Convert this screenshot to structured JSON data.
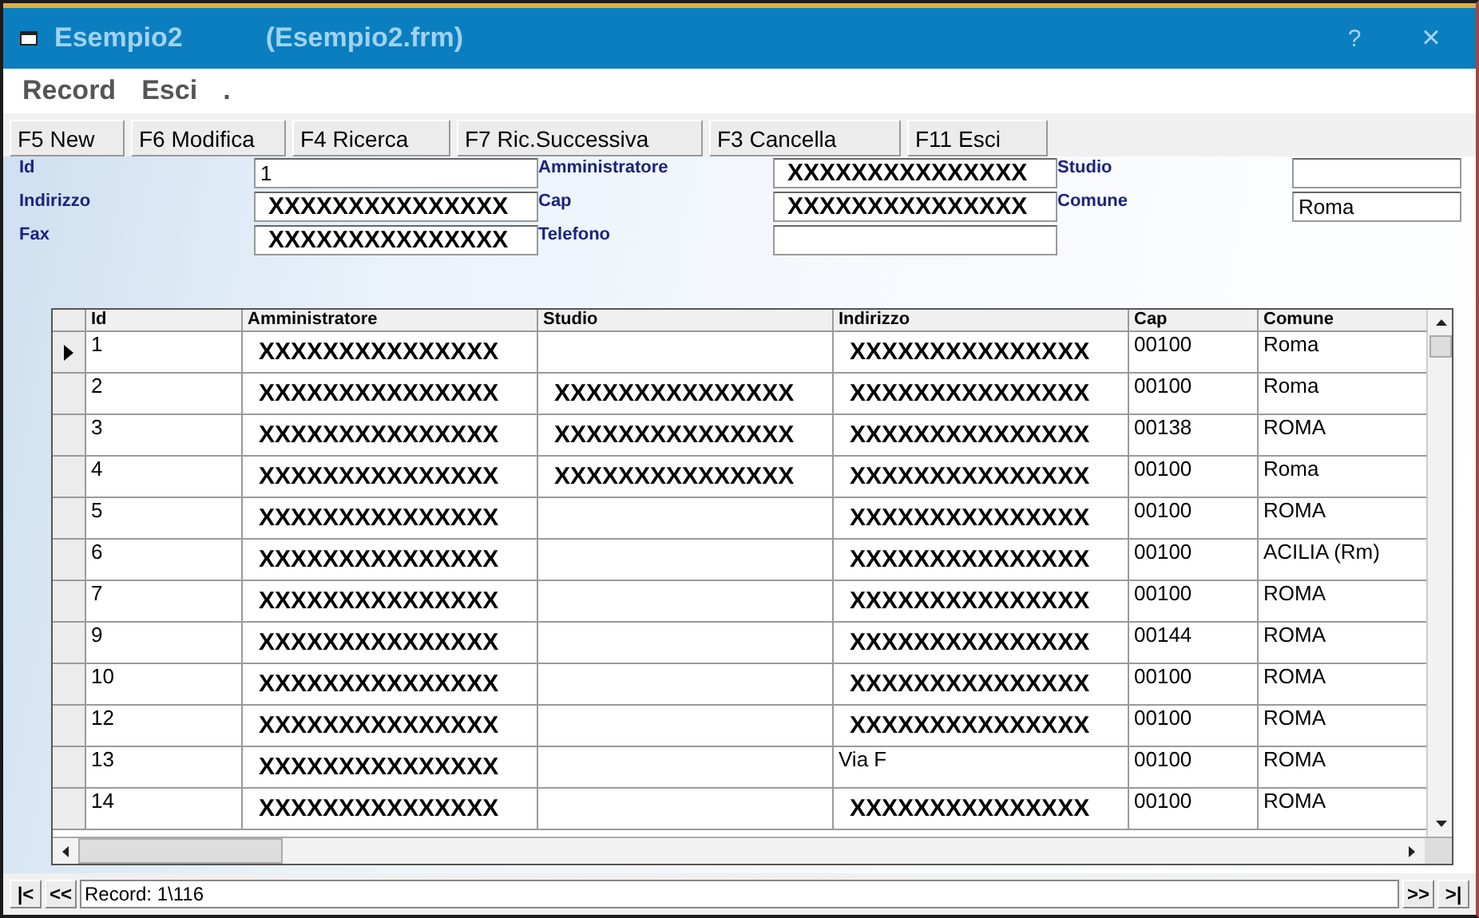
{
  "window": {
    "title": "Esempio2",
    "subtitle": "(Esempio2.frm)",
    "buttons": [
      "?",
      "×"
    ]
  },
  "menu": [
    "Record",
    "Esci",
    "."
  ],
  "toolbar": [
    "F5 New",
    "F6 Modifica",
    "F4 Ricerca",
    "F7 Ric.Successiva",
    "F3 Cancella",
    "F11 Esci"
  ],
  "form": [
    [
      {
        "label": "Id",
        "value": "1"
      },
      {
        "label": "Indirizzo",
        "value": "XXXXXXXXXXXXXXX"
      },
      {
        "label": "Fax",
        "value": "XXXXXXXXXXXXXXX"
      }
    ],
    [
      {
        "label": "Amministratore",
        "value": "XXXXXXXXXXXXXXX"
      },
      {
        "label": "Cap",
        "value": "XXXXXXXXXXXXXXX"
      },
      {
        "label": "Telefono"
      }
    ],
    [
      {
        "label": "Studio"
      },
      {
        "label": "Comune",
        "value": "Roma"
      }
    ]
  ],
  "table": {
    "columns": [
      "Id",
      "Amministratore",
      "Studio",
      "Indirizzo",
      "Cap",
      "Comune"
    ],
    "rows": [
      {
        "selected": true,
        "cells": [
          "1",
          "XXXXXXXXXXXXXXX",
          "",
          "XXXXXXXXXXXXXXX",
          "00100",
          "Roma"
        ]
      },
      {
        "selected": false,
        "cells": [
          "2",
          "XXXXXXXXXXXXXXX",
          "XXXXXXXXXXXXXXX",
          "XXXXXXXXXXXXXXX",
          "00100",
          "Roma"
        ]
      },
      {
        "selected": false,
        "cells": [
          "3",
          "XXXXXXXXXXXXXXX",
          "XXXXXXXXXXXXXXX",
          "XXXXXXXXXXXXXXX",
          "00138",
          "ROMA"
        ]
      },
      {
        "selected": false,
        "cells": [
          "4",
          "XXXXXXXXXXXXXXX",
          "XXXXXXXXXXXXXXX",
          "XXXXXXXXXXXXXXX",
          "00100",
          "Roma"
        ]
      },
      {
        "selected": false,
        "cells": [
          "5",
          "XXXXXXXXXXXXXXX",
          "",
          "XXXXXXXXXXXXXXX",
          "00100",
          "ROMA"
        ]
      },
      {
        "selected": false,
        "cells": [
          "6",
          "XXXXXXXXXXXXXXX",
          "",
          "XXXXXXXXXXXXXXX",
          "00100",
          "ACILIA (Rm)"
        ]
      },
      {
        "selected": false,
        "cells": [
          "7",
          "XXXXXXXXXXXXXXX",
          "",
          "XXXXXXXXXXXXXXX",
          "00100",
          "ROMA"
        ]
      },
      {
        "selected": false,
        "cells": [
          "9",
          "XXXXXXXXXXXXXXX",
          "",
          "XXXXXXXXXXXXXXX",
          "00144",
          "ROMA"
        ]
      },
      {
        "selected": false,
        "cells": [
          "10",
          "XXXXXXXXXXXXXXX",
          "",
          "XXXXXXXXXXXXXXX",
          "00100",
          "ROMA"
        ]
      },
      {
        "selected": false,
        "cells": [
          "12",
          "XXXXXXXXXXXXXXX",
          "",
          "XXXXXXXXXXXXXXX",
          "00100",
          "ROMA"
        ]
      },
      {
        "selected": false,
        "cells": [
          "13",
          "XXXXXXXXXXXXXXX",
          "",
          "Via F",
          "00100",
          "ROMA"
        ]
      },
      {
        "selected": false,
        "cells": [
          "14",
          "XXXXXXXXXXXXXXX",
          "",
          "XXXXXXXXXXXXXXX",
          "00100",
          "ROMA"
        ]
      }
    ]
  },
  "navigator": {
    "buttons_left": [
      "|<",
      "<<"
    ],
    "status": "Record: 1\\116",
    "buttons_right": [
      ">>",
      ">|"
    ]
  }
}
